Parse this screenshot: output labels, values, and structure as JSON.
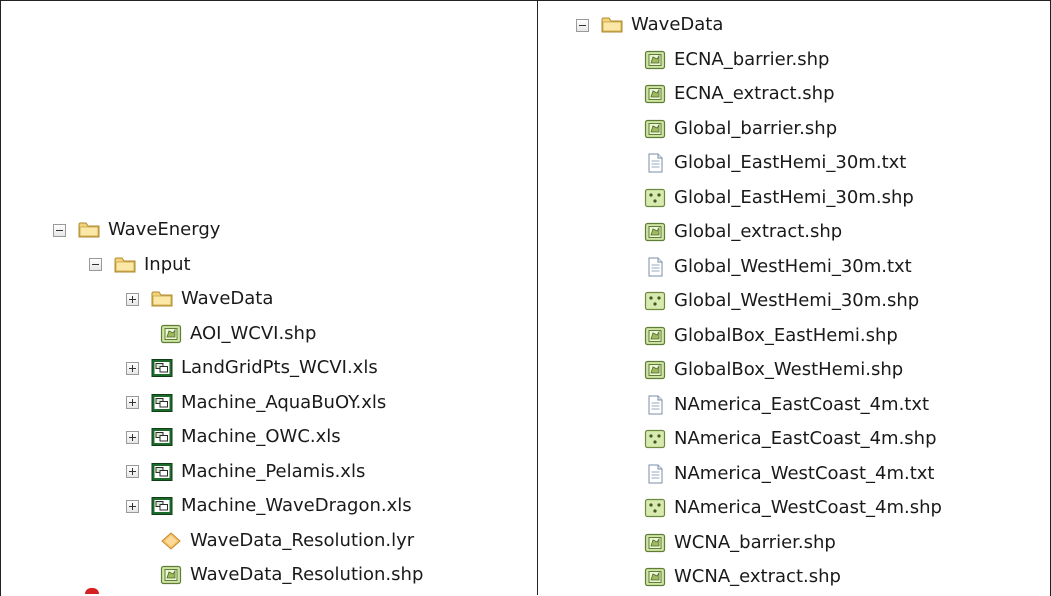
{
  "left_tree": [
    {
      "label": "WaveEnergy",
      "icon": "folder-icon",
      "expander": "minus"
    },
    {
      "label": "Input",
      "icon": "folder-icon",
      "expander": "minus"
    },
    {
      "label": "WaveData",
      "icon": "folder-icon",
      "expander": "plus"
    },
    {
      "label": "AOI_WCVI.shp",
      "icon": "polygon-shapefile-icon",
      "expander": "none"
    },
    {
      "label": "LandGridPts_WCVI.xls",
      "icon": "excel-table-icon",
      "expander": "plus"
    },
    {
      "label": "Machine_AquaBuOY.xls",
      "icon": "excel-table-icon",
      "expander": "plus"
    },
    {
      "label": "Machine_OWC.xls",
      "icon": "excel-table-icon",
      "expander": "plus"
    },
    {
      "label": "Machine_Pelamis.xls",
      "icon": "excel-table-icon",
      "expander": "plus"
    },
    {
      "label": "Machine_WaveDragon.xls",
      "icon": "excel-table-icon",
      "expander": "plus"
    },
    {
      "label": "WaveData_Resolution.lyr",
      "icon": "layer-file-icon",
      "expander": "none"
    },
    {
      "label": "WaveData_Resolution.shp",
      "icon": "polygon-shapefile-icon",
      "expander": "none"
    }
  ],
  "right_tree": [
    {
      "label": "WaveData",
      "icon": "folder-icon",
      "expander": "minus"
    },
    {
      "label": "ECNA_barrier.shp",
      "icon": "polygon-shapefile-icon",
      "expander": "none"
    },
    {
      "label": "ECNA_extract.shp",
      "icon": "polygon-shapefile-icon",
      "expander": "none"
    },
    {
      "label": "Global_barrier.shp",
      "icon": "polygon-shapefile-icon",
      "expander": "none"
    },
    {
      "label": "Global_EastHemi_30m.txt",
      "icon": "text-file-icon",
      "expander": "none"
    },
    {
      "label": "Global_EastHemi_30m.shp",
      "icon": "point-shapefile-icon",
      "expander": "none"
    },
    {
      "label": "Global_extract.shp",
      "icon": "polygon-shapefile-icon",
      "expander": "none"
    },
    {
      "label": "Global_WestHemi_30m.txt",
      "icon": "text-file-icon",
      "expander": "none"
    },
    {
      "label": "Global_WestHemi_30m.shp",
      "icon": "point-shapefile-icon",
      "expander": "none"
    },
    {
      "label": "GlobalBox_EastHemi.shp",
      "icon": "polygon-shapefile-icon",
      "expander": "none"
    },
    {
      "label": "GlobalBox_WestHemi.shp",
      "icon": "polygon-shapefile-icon",
      "expander": "none"
    },
    {
      "label": "NAmerica_EastCoast_4m.txt",
      "icon": "text-file-icon",
      "expander": "none"
    },
    {
      "label": "NAmerica_EastCoast_4m.shp",
      "icon": "point-shapefile-icon",
      "expander": "none"
    },
    {
      "label": "NAmerica_WestCoast_4m.txt",
      "icon": "text-file-icon",
      "expander": "none"
    },
    {
      "label": "NAmerica_WestCoast_4m.shp",
      "icon": "point-shapefile-icon",
      "expander": "none"
    },
    {
      "label": "WCNA_barrier.shp",
      "icon": "polygon-shapefile-icon",
      "expander": "none"
    },
    {
      "label": "WCNA_extract.shp",
      "icon": "polygon-shapefile-icon",
      "expander": "none"
    }
  ]
}
